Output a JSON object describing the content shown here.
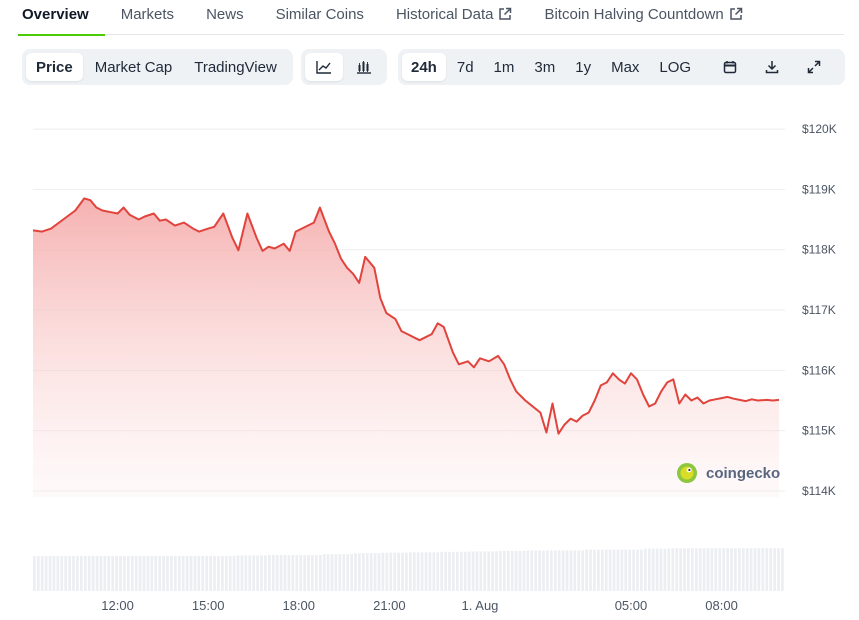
{
  "nav": {
    "tabs": [
      {
        "label": "Overview",
        "active": true
      },
      {
        "label": "Markets"
      },
      {
        "label": "News"
      },
      {
        "label": "Similar Coins"
      },
      {
        "label": "Historical Data",
        "external": true
      },
      {
        "label": "Bitcoin Halving Countdown",
        "external": true
      }
    ]
  },
  "toolbar": {
    "metric_tabs": [
      {
        "label": "Price",
        "active": true
      },
      {
        "label": "Market Cap"
      },
      {
        "label": "TradingView"
      }
    ],
    "chart_style_icons": [
      "line-chart-icon",
      "candlestick-chart-icon"
    ],
    "ranges": [
      {
        "label": "24h",
        "active": true
      },
      {
        "label": "7d"
      },
      {
        "label": "1m"
      },
      {
        "label": "3m"
      },
      {
        "label": "1y"
      },
      {
        "label": "Max"
      },
      {
        "label": "LOG"
      }
    ],
    "tool_icons": [
      "calendar-icon",
      "download-icon",
      "expand-icon"
    ]
  },
  "watermark": {
    "text": "coingecko",
    "icon": "coingecko-logo-icon"
  },
  "colors": {
    "line": "#e0443c",
    "fill_top": "#f4a3a3",
    "volume": "#eceef1",
    "accent": "#4bcc00"
  },
  "chart_data": {
    "type": "area",
    "title": "",
    "xlabel": "",
    "ylabel": "",
    "ylim": [
      113900,
      120200
    ],
    "y_ticks": [
      114000,
      115000,
      116000,
      117000,
      118000,
      119000,
      120000
    ],
    "y_tick_labels": [
      "$114K",
      "$115K",
      "$116K",
      "$117K",
      "$118K",
      "$119K",
      "$120K"
    ],
    "x_ticks": [
      12,
      15,
      18,
      21,
      24,
      29,
      32
    ],
    "x_tick_labels": [
      "12:00",
      "15:00",
      "18:00",
      "21:00",
      "1. Aug",
      "05:00",
      "08:00"
    ],
    "xlim": [
      9.2,
      34.1
    ],
    "grid": true,
    "series": [
      {
        "x": [
          9.2,
          9.5,
          9.8,
          10.2,
          10.6,
          10.9,
          11.1,
          11.3,
          11.5,
          11.8,
          12.0,
          12.2,
          12.4,
          12.7,
          12.9,
          13.2,
          13.4,
          13.6,
          13.9,
          14.2,
          14.5,
          14.7,
          15.0,
          15.2,
          15.5,
          15.8,
          16.0,
          16.3,
          16.6,
          16.8,
          17.0,
          17.2,
          17.5,
          17.7,
          17.9,
          18.1,
          18.3,
          18.5,
          18.7,
          19.0,
          19.2,
          19.4,
          19.6,
          19.8,
          20.0,
          20.2,
          20.5,
          20.7,
          20.9,
          21.2,
          21.4,
          21.6,
          21.8,
          22.0,
          22.2,
          22.4,
          22.6,
          22.8,
          23.1,
          23.3,
          23.6,
          23.8,
          24.0,
          24.3,
          24.6,
          24.8,
          25.0,
          25.2,
          25.5,
          25.7,
          26.0,
          26.2,
          26.4,
          26.6,
          26.8,
          27.0,
          27.2,
          27.4,
          27.6,
          27.8,
          28.0,
          28.2,
          28.4,
          28.6,
          28.8,
          29.0,
          29.2,
          29.4,
          29.6,
          29.8,
          30.0,
          30.2,
          30.4,
          30.6,
          30.8,
          31.0,
          31.2,
          31.4,
          31.6,
          31.8,
          32.0,
          32.2,
          32.4,
          32.6,
          32.8,
          33.0,
          33.2,
          33.5,
          33.7,
          33.9
        ],
        "y": [
          118320,
          118300,
          118350,
          118500,
          118650,
          118850,
          118820,
          118700,
          118650,
          118620,
          118600,
          118700,
          118580,
          118500,
          118550,
          118600,
          118480,
          118500,
          118400,
          118450,
          118350,
          118300,
          118350,
          118380,
          118600,
          118200,
          117990,
          118600,
          118200,
          117980,
          118050,
          118020,
          118100,
          117980,
          118300,
          118350,
          118400,
          118450,
          118700,
          118300,
          118100,
          117850,
          117700,
          117600,
          117450,
          117880,
          117700,
          117200,
          116950,
          116850,
          116650,
          116600,
          116550,
          116500,
          116550,
          116600,
          116780,
          116720,
          116300,
          116100,
          116150,
          116050,
          116200,
          116150,
          116240,
          116100,
          115850,
          115650,
          115500,
          115420,
          115300,
          114970,
          115450,
          114950,
          115100,
          115200,
          115150,
          115250,
          115300,
          115500,
          115750,
          115800,
          115950,
          115850,
          115780,
          115950,
          115850,
          115600,
          115400,
          115450,
          115650,
          115800,
          115850,
          115450,
          115600,
          115500,
          115550,
          115450,
          115500,
          115520,
          115540,
          115560,
          115530,
          115510,
          115490,
          115520,
          115500,
          115510,
          115500,
          115510
        ]
      }
    ],
    "volume": {
      "x_start": 9.2,
      "x_end": 34.1,
      "bars": 192,
      "levels": [
        0.78,
        0.78,
        0.78,
        0.78,
        0.78,
        0.78,
        0.78,
        0.79,
        0.8,
        0.8,
        0.82,
        0.84,
        0.85,
        0.86,
        0.87,
        0.88,
        0.89,
        0.9,
        0.9,
        0.92,
        0.92,
        0.94,
        0.95,
        0.95,
        0.95,
        0.95
      ]
    }
  }
}
